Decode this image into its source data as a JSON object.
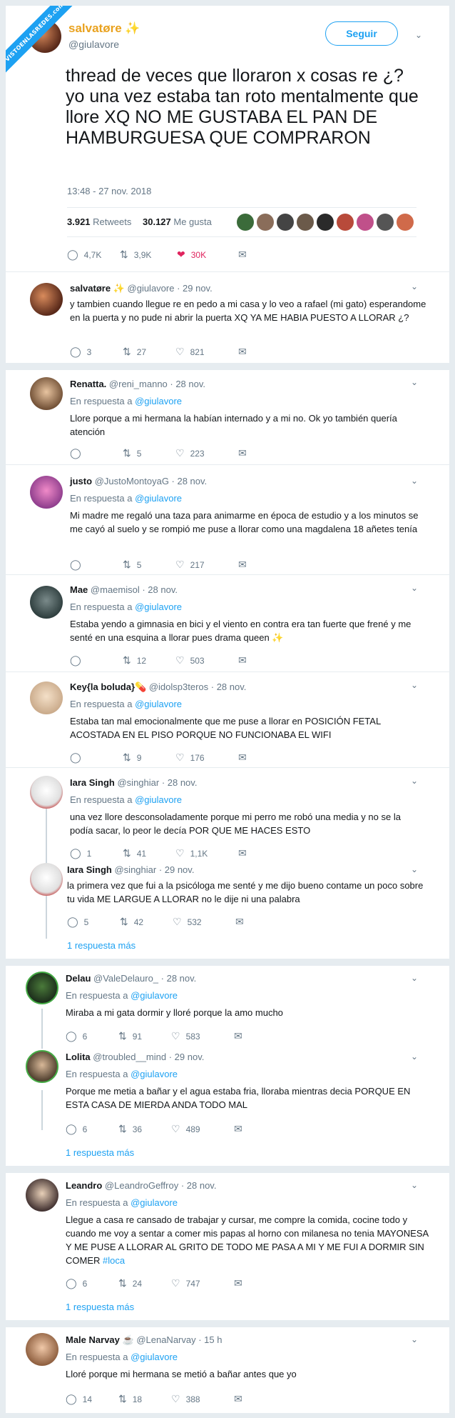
{
  "watermark": "VISTOENLASREDES.com",
  "main": {
    "name": "salvatøre",
    "name_emoji": "✨",
    "handle": "@giulavore",
    "follow_label": "Seguir",
    "text": "thread de veces que lloraron x cosas re ¿? yo una vez estaba tan roto mentalmente que llore XQ NO ME GUSTABA EL PAN DE HAMBURGUESA QUE COMPRARON",
    "time": "13:48 - 27 nov. 2018",
    "retweets": "3.921",
    "retweets_label": "Retweets",
    "likes": "30.127",
    "likes_label": "Me gusta",
    "replies": "4,7K",
    "rts": "3,9K",
    "favs": "30K"
  },
  "icons": {
    "reply": "reply-icon",
    "retweet": "retweet-icon",
    "like": "heart-icon",
    "dm": "envelope-icon",
    "chevron": "chevron-down-icon"
  },
  "colors": {
    "accent": "#1da1f2",
    "like": "#e0245e",
    "name_gold": "#e9a21f"
  },
  "replies": [
    {
      "name": "salvatøre ✨",
      "handle": "@giulavore · 29 nov.",
      "resp_prefix": "",
      "resp_at": "",
      "text": "y tambien cuando llegue re en pedo a mi casa y lo veo a rafael (mi gato) esperandome en la puerta y no pude ni abrir la puerta XQ YA ME HABIA PUESTO A LLORAR ¿?",
      "reply": "3",
      "rt": "27",
      "like": "821"
    },
    {
      "name": "Renatta.",
      "handle": "@reni_manno · 28 nov.",
      "resp_prefix": "En respuesta a ",
      "resp_at": "@giulavore",
      "text": "Llore porque a mi hermana la habían internado y a mi no. Ok yo también quería atención",
      "reply": "",
      "rt": "5",
      "like": "223"
    },
    {
      "name": "justo",
      "handle": "@JustoMontoyaG · 28 nov.",
      "resp_prefix": "En respuesta a ",
      "resp_at": "@giulavore",
      "text": "Mi madre me regaló una taza para animarme en época de estudio y a los minutos se me cayó al suelo y se rompió me puse a llorar como una magdalena 18 añetes tenía",
      "reply": "",
      "rt": "5",
      "like": "217"
    },
    {
      "name": "Mae",
      "handle": "@maemisol · 28 nov.",
      "resp_prefix": "En respuesta a ",
      "resp_at": "@giulavore",
      "text": "Estaba yendo a gimnasia en bici y el viento en contra era tan fuerte que frené y me senté en una esquina a llorar pues drama queen ✨",
      "reply": "",
      "rt": "12",
      "like": "503"
    },
    {
      "name": "Key{la boluda}💊",
      "handle": "@idolsp3teros · 28 nov.",
      "resp_prefix": "En respuesta a ",
      "resp_at": "@giulavore",
      "text": "Estaba tan mal emocionalmente que me puse a llorar en POSICIÓN FETAL ACOSTADA EN EL PISO PORQUE NO FUNCIONABA EL WIFI",
      "reply": "",
      "rt": "9",
      "like": "176"
    },
    {
      "name": "Iara Singh",
      "handle": "@singhiar · 28 nov.",
      "resp_prefix": "En respuesta a ",
      "resp_at": "@giulavore",
      "text": "una vez llore desconsoladamente porque mi perro me robó una media y no se la podía sacar, lo peor le decía POR QUE ME HACES ESTO",
      "reply": "1",
      "rt": "41",
      "like": "1,1K"
    },
    {
      "name": "Iara Singh",
      "handle": "@singhiar · 29 nov.",
      "resp_prefix": "",
      "resp_at": "",
      "text": "la primera vez que fui a la psicóloga me senté y me dijo bueno contame un poco sobre tu vida ME LARGUE A LLORAR no le dije ni una palabra",
      "reply": "5",
      "rt": "42",
      "like": "532",
      "more": "1 respuesta más"
    },
    {
      "name": "Delau",
      "handle": "@ValeDelauro_ · 28 nov.",
      "resp_prefix": "En respuesta a ",
      "resp_at": "@giulavore",
      "text": "Miraba a mi gata dormir y lloré porque la amo mucho",
      "reply": "6",
      "rt": "91",
      "like": "583"
    },
    {
      "name": "Lolita",
      "handle": "@troubled__mind · 29 nov.",
      "resp_prefix": "En respuesta a ",
      "resp_at": "@giulavore",
      "text": "Porque me metia a bañar y el agua estaba fria, lloraba mientras decia PORQUE EN ESTA CASA DE MIERDA ANDA TODO MAL",
      "reply": "6",
      "rt": "36",
      "like": "489",
      "more": "1 respuesta más"
    },
    {
      "name": "Leandro",
      "handle": "@LeandroGeffroy · 28 nov.",
      "resp_prefix": "En respuesta a ",
      "resp_at": "@giulavore",
      "text": "Llegue a casa re cansado de trabajar y cursar, me compre la comida, cocine todo y cuando me voy a sentar a comer mis papas al horno con milanesa no tenia MAYONESA Y ME PUSE A LLORAR AL GRITO DE TODO ME PASA A MI Y ME FUI A DORMIR SIN COMER",
      "hashtag": "#loca",
      "reply": "6",
      "rt": "24",
      "like": "747",
      "more": "1 respuesta más"
    },
    {
      "name": "Male Narvay ☕",
      "handle": "@LenaNarvay · 15 h",
      "resp_prefix": "En respuesta a ",
      "resp_at": "@giulavore",
      "text": "Lloré porque mi hermana se metió a bañar antes que yo",
      "reply": "14",
      "rt": "18",
      "like": "388"
    }
  ]
}
